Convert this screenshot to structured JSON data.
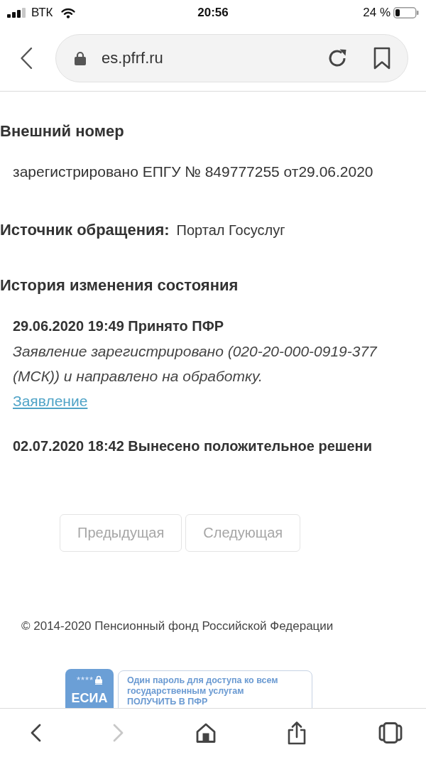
{
  "status_bar": {
    "carrier": "ВТК",
    "time": "20:56",
    "battery": "24 %"
  },
  "browser": {
    "url": "es.pfrf.ru"
  },
  "external_number": {
    "heading": "Внешний номер",
    "value": "зарегистрировано ЕПГУ № 849777255 от29.06.2020"
  },
  "source": {
    "label": "Источник обращения:",
    "value": "Портал Госуслуг"
  },
  "history": {
    "heading": "История изменения состояния",
    "entries": [
      {
        "title": "29.06.2020 19:49 Принято ПФР",
        "description_lines": [
          "Заявление зарегистрировано (020-20-000-0919-377",
          "(МСК)) и направлено на обработку."
        ],
        "link": "Заявление"
      },
      {
        "title": "02.07.2020 18:42 Вынесено положительное решени"
      }
    ]
  },
  "pagination": [
    {
      "label": "Предыдущая",
      "disabled": true
    },
    {
      "label": "Следующая",
      "disabled": true
    }
  ],
  "footer": {
    "copyright": "© 2014-2020 Пенсионный фонд Российской Федерации"
  },
  "esia_banner": {
    "mask": "****",
    "title": "ЕСИА",
    "lines": [
      "Один пароль для доступа ко всем",
      "государственным услугам"
    ],
    "action": "ПОЛУЧИТЬ В ПФР"
  },
  "toolbar": [
    {
      "kind": "back",
      "disabled": false
    },
    {
      "kind": "forward",
      "disabled": true
    },
    {
      "kind": "home",
      "disabled": false
    },
    {
      "kind": "share",
      "disabled": false
    },
    {
      "kind": "tabs",
      "disabled": false
    }
  ]
}
